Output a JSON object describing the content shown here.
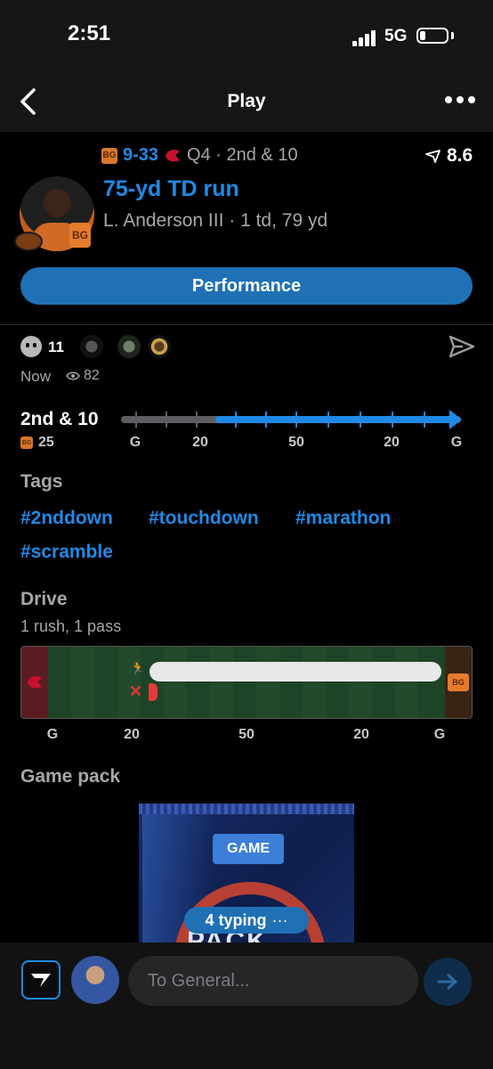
{
  "status": {
    "time": "2:51",
    "network": "5G"
  },
  "nav": {
    "title": "Play"
  },
  "play": {
    "score_away": "9",
    "score_sep": "-",
    "score_home": "33",
    "game_state": "Q4 · 2nd & 10",
    "rating": "8.6",
    "title": "75-yd TD run",
    "player_line": "L. Anderson III · 1 td, 79 yd",
    "performance_label": "Performance"
  },
  "reactions": {
    "count": "11",
    "time": "Now",
    "views": "82"
  },
  "field_position": {
    "down": "2nd & 10",
    "yard_line": "25",
    "scale": [
      "G",
      "20",
      "50",
      "20",
      "G"
    ],
    "progress": 0.72
  },
  "tags": {
    "heading": "Tags",
    "items": [
      "#2nddown",
      "#touchdown",
      "#marathon",
      "#scramble"
    ]
  },
  "drive": {
    "heading": "Drive",
    "summary": "1 rush, 1 pass",
    "scale": [
      "G",
      "20",
      "50",
      "20",
      "G"
    ]
  },
  "game_pack": {
    "heading": "Game pack",
    "badge": "GAME",
    "word": "PACK",
    "typing": "4 typing"
  },
  "composer": {
    "placeholder": "To General..."
  },
  "colors": {
    "accent": "#1f8ae6",
    "button": "#1f70b5",
    "muted": "#a7a7ab"
  }
}
